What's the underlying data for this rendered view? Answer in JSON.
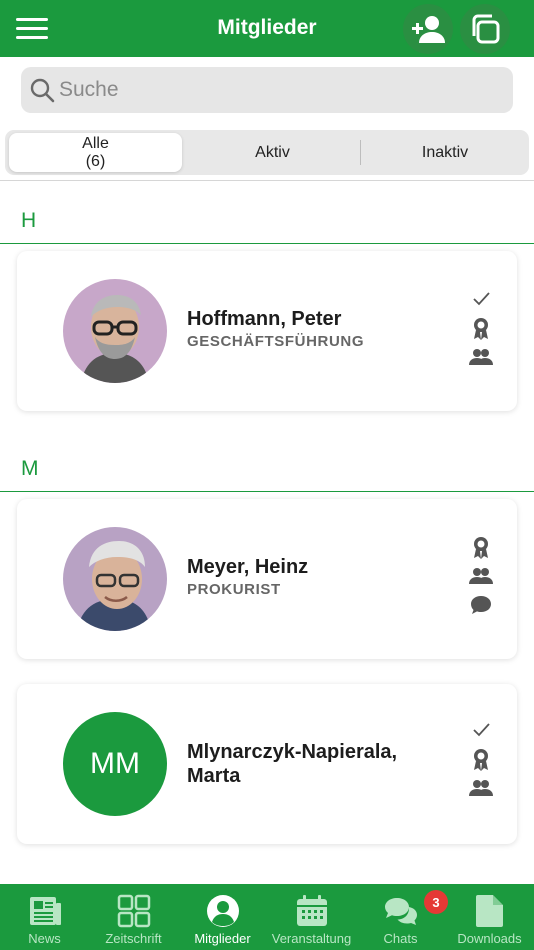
{
  "header": {
    "title": "Mitglieder",
    "menu_icon": "hamburger-menu-icon",
    "add_icon": "add-person-icon",
    "copy_icon": "copy-icon"
  },
  "search": {
    "placeholder": "Suche",
    "value": ""
  },
  "filter": {
    "tabs": [
      {
        "label": "Alle",
        "count": "(6)",
        "active": true
      },
      {
        "label": "Aktiv",
        "active": false
      },
      {
        "label": "Inaktiv",
        "active": false
      }
    ]
  },
  "sections": [
    {
      "letter": "H",
      "members": [
        {
          "name": "Hoffmann, Peter",
          "role": "GESCHÄFTSFÜHRUNG",
          "avatar": "photo",
          "status_icons": [
            "check-icon",
            "award-icon",
            "group-icon"
          ]
        }
      ]
    },
    {
      "letter": "M",
      "members": [
        {
          "name": "Meyer, Heinz",
          "role": "PROKURIST",
          "avatar": "photo",
          "status_icons": [
            "award-icon",
            "group-icon",
            "chat-icon"
          ]
        },
        {
          "name_line1": "Mlynarczyk-Napierala,",
          "name_line2": "Marta",
          "initials": "MM",
          "avatar": "initials",
          "status_icons": [
            "check-icon",
            "award-icon",
            "group-icon"
          ]
        }
      ]
    }
  ],
  "bottom_nav": {
    "items": [
      {
        "label": "News",
        "icon": "newspaper-icon",
        "active": false
      },
      {
        "label": "Zeitschrift",
        "icon": "grid-icon",
        "active": false
      },
      {
        "label": "Mitglieder",
        "icon": "person-circle-icon",
        "active": true
      },
      {
        "label": "Veranstaltung",
        "icon": "calendar-icon",
        "active": false
      },
      {
        "label": "Chats",
        "icon": "chat-bubbles-icon",
        "active": false,
        "badge": "3"
      },
      {
        "label": "Downloads",
        "icon": "document-icon",
        "active": false
      }
    ]
  },
  "colors": {
    "primary": "#1b9a3e",
    "badge": "#e53935",
    "card_bg": "#ffffff"
  }
}
